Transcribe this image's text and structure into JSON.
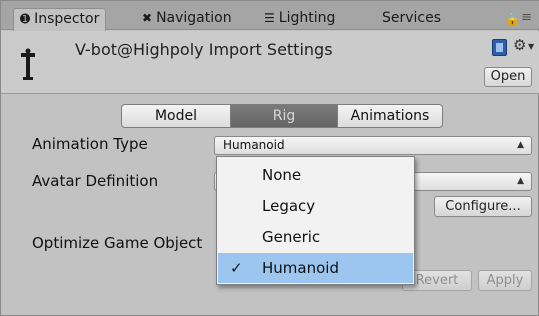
{
  "tabs": [
    {
      "label": "Inspector",
      "icon": "info-icon"
    },
    {
      "label": "Navigation",
      "icon": "navigation-icon"
    },
    {
      "label": "Lighting",
      "icon": "lighting-icon"
    },
    {
      "label": "Services",
      "icon": ""
    }
  ],
  "header": {
    "title": "V-bot@Highpoly Import Settings",
    "open_label": "Open"
  },
  "segments": [
    "Model",
    "Rig",
    "Animations"
  ],
  "active_segment": "Rig",
  "rows": {
    "animation_type_label": "Animation Type",
    "animation_type_value": "Humanoid",
    "avatar_definition_label": "Avatar Definition",
    "optimize_label": "Optimize Game Object"
  },
  "buttons": {
    "configure": "Configure...",
    "revert": "Revert",
    "apply": "Apply"
  },
  "dropdown": {
    "options": [
      "None",
      "Legacy",
      "Generic",
      "Humanoid"
    ],
    "selected": "Humanoid"
  },
  "colors": {
    "selection": "#9cc6ef",
    "active_segment": "#6e6e6e",
    "panel": "#c2c2c2"
  }
}
